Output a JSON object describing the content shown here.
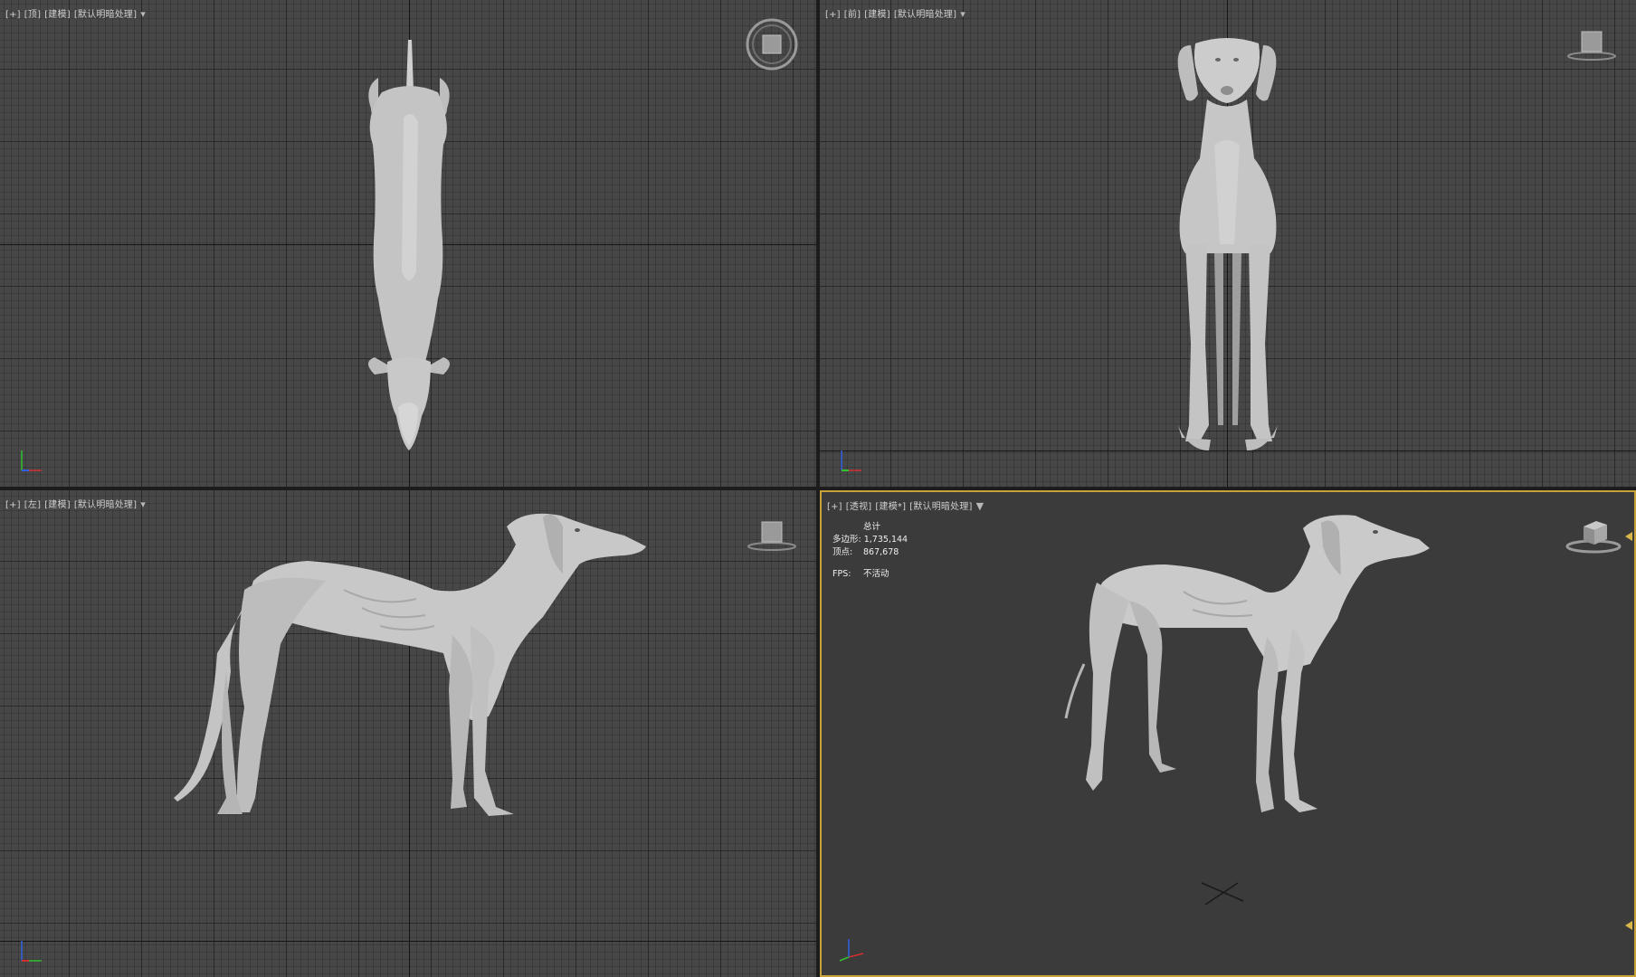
{
  "viewports": {
    "top": {
      "plus": "[+]",
      "view": "[顶]",
      "shading": "[建模]",
      "lighting": "[默认明暗处理]"
    },
    "front": {
      "plus": "[+]",
      "view": "[前]",
      "shading": "[建模]",
      "lighting": "[默认明暗处理]"
    },
    "left": {
      "plus": "[+]",
      "view": "[左]",
      "shading": "[建模]",
      "lighting": "[默认明暗处理]"
    },
    "perspective": {
      "plus": "[+]",
      "view": "[透视]",
      "shading": "[建模*]",
      "lighting": "[默认明暗处理]"
    }
  },
  "stats": {
    "total_label": "总计",
    "polys_label": "多边形:",
    "polys_value": "1,735,144",
    "verts_label": "顶点:",
    "verts_value": "867,678",
    "fps_label": "FPS:",
    "fps_value": "不活动"
  },
  "icons": {
    "filter": "filter-icon",
    "axis": "axis-tripod-icon",
    "viewcube": "viewcube-icon",
    "steering": "steering-wheel-icon"
  },
  "colors": {
    "active_border": "#c8a13a",
    "axis_x": "#d23030",
    "axis_y": "#30c030",
    "axis_z": "#3060e0",
    "model": "#c8c8c8"
  }
}
